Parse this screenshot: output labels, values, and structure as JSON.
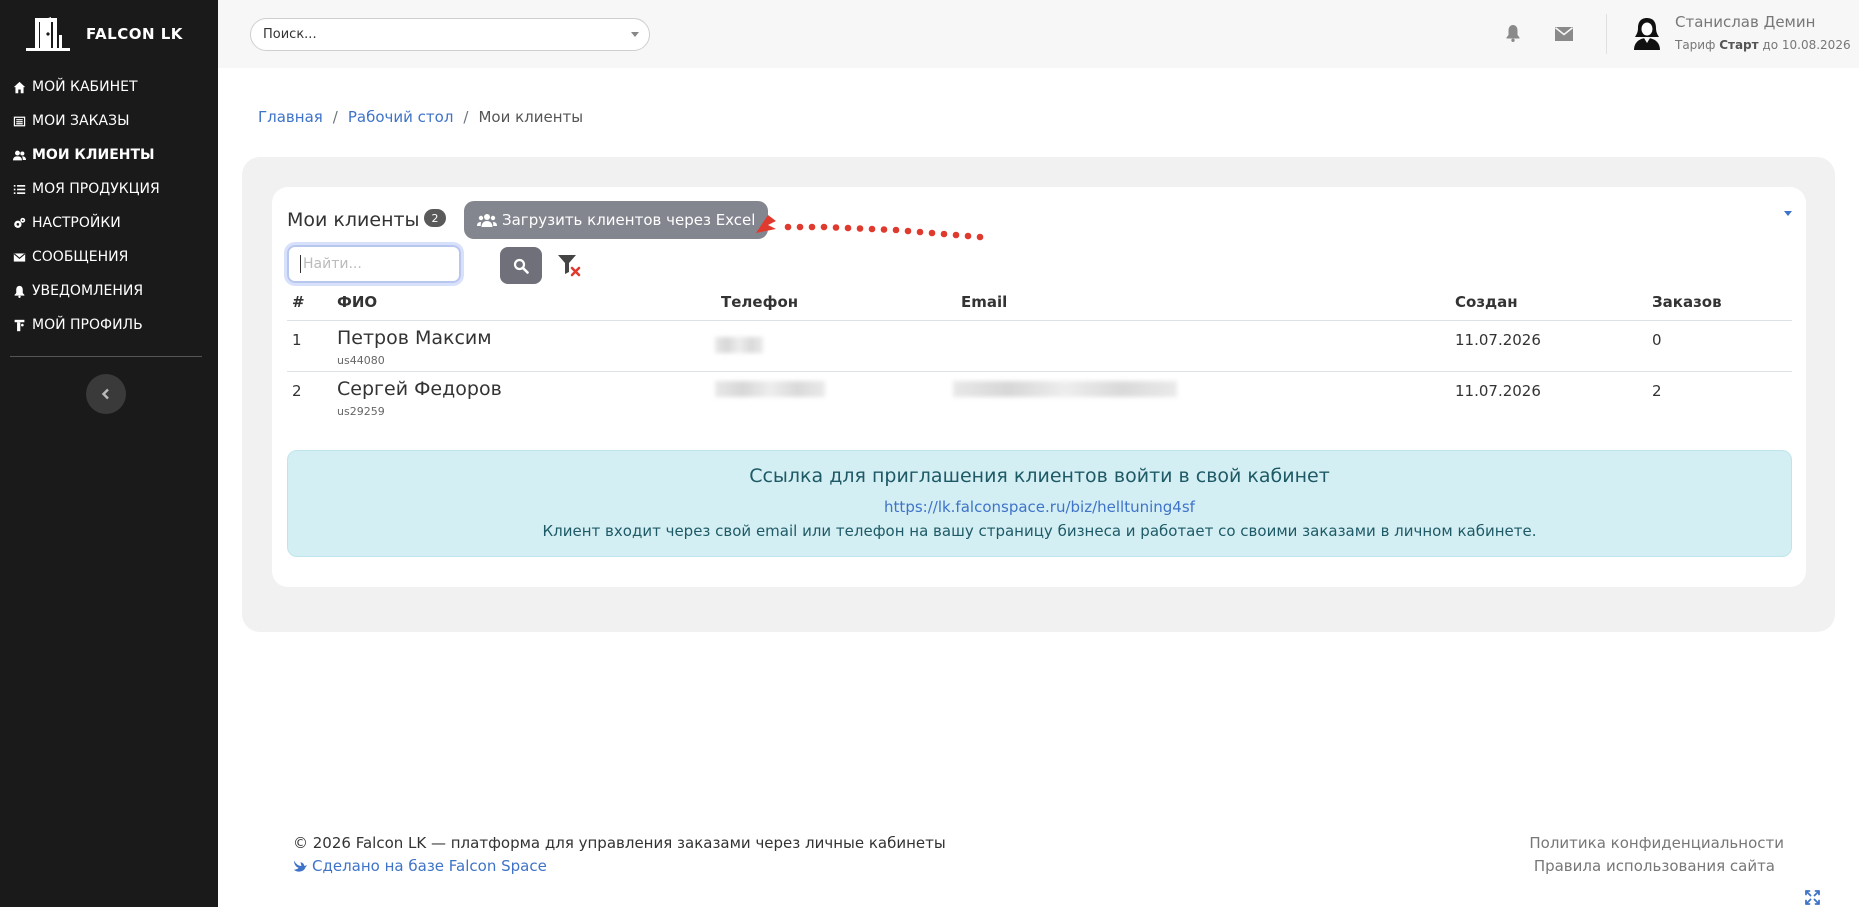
{
  "brand": {
    "name": "FALCON LK"
  },
  "sidebar": {
    "items": [
      {
        "label": "МОЙ КАБИНЕТ",
        "icon": "home-icon"
      },
      {
        "label": "МОИ ЗАКАЗЫ",
        "icon": "list-icon"
      },
      {
        "label": "МОИ КЛИЕНТЫ",
        "icon": "users-icon",
        "active": true
      },
      {
        "label": "МОЯ ПРОДУКЦИЯ",
        "icon": "list-ul-icon"
      },
      {
        "label": "НАСТРОЙКИ",
        "icon": "cogs-icon"
      },
      {
        "label": "СООБЩЕНИЯ",
        "icon": "envelope-icon"
      },
      {
        "label": "УВЕДОМЛЕНИЯ",
        "icon": "bell-icon"
      },
      {
        "label": "МОЙ ПРОФИЛЬ",
        "icon": "user-icon"
      }
    ]
  },
  "header": {
    "search_placeholder": "Поиск...",
    "user_name": "Станислав Демин",
    "tariff_prefix": "Тариф",
    "tariff_name": "Старт",
    "tariff_suffix": "до 10.08.2026"
  },
  "breadcrumb": {
    "home": "Главная",
    "desk": "Рабочий стол",
    "current": "Мои клиенты"
  },
  "clients": {
    "title": "Мои клиенты",
    "count": "2",
    "upload_label": "Загрузить клиентов через Excel",
    "find_placeholder": "Найти...",
    "columns": {
      "num": "#",
      "fio": "ФИО",
      "phone": "Телефон",
      "email": "Email",
      "created": "Создан",
      "orders": "Заказов"
    },
    "rows": [
      {
        "num": "1",
        "fio": "Петров Максим",
        "uid": "us44080",
        "created": "11.07.2026",
        "orders": "0"
      },
      {
        "num": "2",
        "fio": "Сергей Федоров",
        "uid": "us29259",
        "created": "11.07.2026",
        "orders": "2"
      }
    ]
  },
  "invite": {
    "title": "Ссылка для приглашения клиентов войти в свой кабинет",
    "link": "https://lk.falconspace.ru/biz/helltuning4sf",
    "text": "Клиент входит через свой email или телефон на вашу страницу бизнеса и работает со своими заказами в личном кабинете."
  },
  "footer": {
    "copyright": "© 2026 Falcon LK — платформа для управления заказами через личные кабинеты",
    "made_with": "Сделано на базе Falcon Space",
    "privacy": "Политика конфиденциальности",
    "rules": "Правила использования сайта"
  },
  "colors": {
    "sidebar_bg": "#1a1a1a",
    "link": "#3f73c8",
    "invite_bg": "#d4eff3",
    "annotation_arrow": "#e03a2f"
  }
}
